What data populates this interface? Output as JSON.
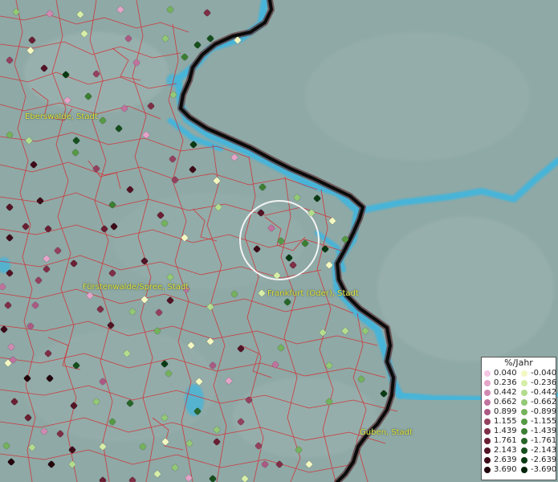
{
  "map": {
    "cities": [
      {
        "id": "eberswalde",
        "name": "Eberswalde, Stadt"
      },
      {
        "id": "fuerstenwalde",
        "name": "Fürstenwalde/Spree, Stadt"
      },
      {
        "id": "frankfurt",
        "name": "Frankfurt (Oder), Stadt"
      },
      {
        "id": "guben",
        "name": "Guben, Stadt"
      }
    ],
    "colors": {
      "terrain": "#8fa9a6",
      "water": "#3fb6de",
      "border": "#111111",
      "admin_lines": "#d8262b",
      "label": "#e8e23a"
    }
  },
  "legend": {
    "title": "%/Jahr",
    "positive": [
      {
        "value": "0.040",
        "color": "#f4c6e4"
      },
      {
        "value": "0.236",
        "color": "#e3a4c8"
      },
      {
        "value": "0.442",
        "color": "#d08ab2"
      },
      {
        "value": "0.662",
        "color": "#c0739e"
      },
      {
        "value": "0.899",
        "color": "#ab5a84"
      },
      {
        "value": "1.155",
        "color": "#94415f"
      },
      {
        "value": "1.439",
        "color": "#7e2f46"
      },
      {
        "value": "1.761",
        "color": "#6a1f33"
      },
      {
        "value": "2.143",
        "color": "#531425"
      },
      {
        "value": "2.639",
        "color": "#3e0c19"
      },
      {
        "value": "3.690",
        "color": "#24050c"
      }
    ],
    "negative": [
      {
        "value": "-0.040",
        "color": "#f3f7c2"
      },
      {
        "value": "-0.236",
        "color": "#d6eea7"
      },
      {
        "value": "-0.442",
        "color": "#b4dc8f"
      },
      {
        "value": "-0.662",
        "color": "#93c877"
      },
      {
        "value": "-0.899",
        "color": "#74b25d"
      },
      {
        "value": "-1.155",
        "color": "#569945"
      },
      {
        "value": "-1.439",
        "color": "#3c7f33"
      },
      {
        "value": "-1.761",
        "color": "#276628"
      },
      {
        "value": "-2.143",
        "color": "#154f1c"
      },
      {
        "value": "-2.639",
        "color": "#0a3a13"
      },
      {
        "value": "-3.690",
        "color": "#03230a"
      }
    ]
  }
}
